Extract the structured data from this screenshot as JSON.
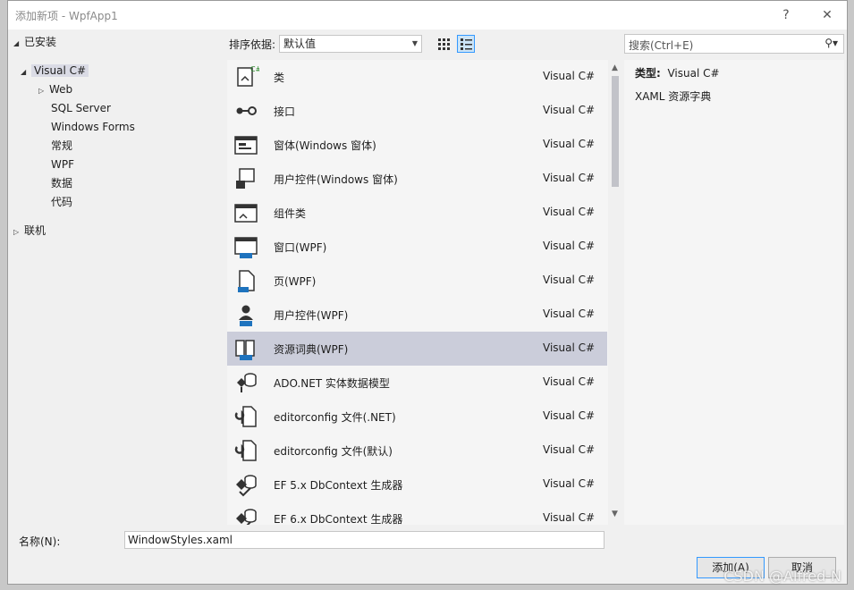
{
  "window": {
    "title": "添加新项 - WpfApp1",
    "help_label": "?",
    "close_label": "✕"
  },
  "tree": {
    "installed": "已安装",
    "visual_csharp": "Visual C#",
    "children": [
      "Web",
      "SQL Server",
      "Windows Forms",
      "常规",
      "WPF",
      "数据",
      "代码"
    ],
    "online": "联机"
  },
  "toolbar": {
    "sort_label": "排序依据:",
    "sort_value": "默认值"
  },
  "search": {
    "placeholder": "搜索(Ctrl+E)"
  },
  "items": [
    {
      "name": "类",
      "lang": "Visual C#",
      "icon": "class-icon"
    },
    {
      "name": "接口",
      "lang": "Visual C#",
      "icon": "interface-icon"
    },
    {
      "name": "窗体(Windows 窗体)",
      "lang": "Visual C#",
      "icon": "form-icon"
    },
    {
      "name": "用户控件(Windows 窗体)",
      "lang": "Visual C#",
      "icon": "user-control-icon"
    },
    {
      "name": "组件类",
      "lang": "Visual C#",
      "icon": "component-class-icon"
    },
    {
      "name": "窗口(WPF)",
      "lang": "Visual C#",
      "icon": "wpf-window-icon"
    },
    {
      "name": "页(WPF)",
      "lang": "Visual C#",
      "icon": "wpf-page-icon"
    },
    {
      "name": "用户控件(WPF)",
      "lang": "Visual C#",
      "icon": "wpf-user-control-icon"
    },
    {
      "name": "资源词典(WPF)",
      "lang": "Visual C#",
      "icon": "resource-dictionary-icon"
    },
    {
      "name": "ADO.NET 实体数据模型",
      "lang": "Visual C#",
      "icon": "ado-net-icon"
    },
    {
      "name": "editorconfig 文件(.NET)",
      "lang": "Visual C#",
      "icon": "editorconfig-icon"
    },
    {
      "name": "editorconfig 文件(默认)",
      "lang": "Visual C#",
      "icon": "editorconfig-icon"
    },
    {
      "name": "EF 5.x DbContext 生成器",
      "lang": "Visual C#",
      "icon": "ef-generator-icon"
    },
    {
      "name": "EF 6.x DbContext 生成器",
      "lang": "Visual C#",
      "icon": "ef-generator-icon"
    }
  ],
  "selected_index": 8,
  "details": {
    "type_label": "类型:",
    "type_value": "Visual C#",
    "description": "XAML 资源字典"
  },
  "bottom": {
    "name_label": "名称(N):",
    "name_value": "WindowStyles.xaml",
    "add_label": "添加(A)",
    "cancel_label": "取消"
  },
  "watermark": "CSDN @Alfred-N",
  "colors": {
    "selection": "#cbcdda",
    "accent": "#3399ff",
    "icon_blue": "#1e73be"
  }
}
